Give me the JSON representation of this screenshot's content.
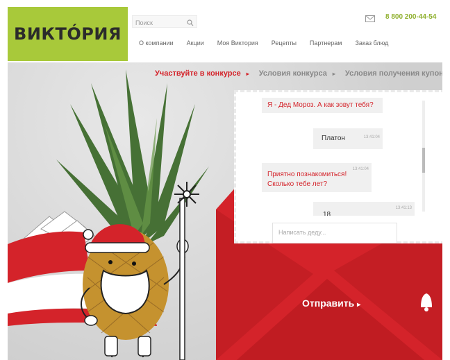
{
  "brand": {
    "logo_text": "ВИКТÓРИЯ",
    "accent": "#a8c93a",
    "red": "#d4232a"
  },
  "header": {
    "search_placeholder": "Поиск",
    "phone": "8 800 200-44-54",
    "nav": [
      "О компании",
      "Акции",
      "Моя Виктория",
      "Рецепты",
      "Партнерам",
      "Заказ блюд"
    ]
  },
  "steps": [
    {
      "label": "Участвуйте в конкурсе",
      "active": true
    },
    {
      "label": "Условия конкурса",
      "active": false
    },
    {
      "label": "Условия получения купона",
      "active": false
    }
  ],
  "chat": {
    "messages": [
      {
        "from": "santa",
        "text": "Я - Дед Мороз. А как зовут тебя?",
        "time": ""
      },
      {
        "from": "user",
        "text": "Платон",
        "time": "13:41:04"
      },
      {
        "from": "santa",
        "text": "Приятно познакомиться! Сколько тебе лет?",
        "time": "13:41:04"
      },
      {
        "from": "user",
        "text": "18",
        "time": "13:41:13"
      }
    ],
    "compose_placeholder": "Написать деду...",
    "send_label": "Отправить"
  }
}
